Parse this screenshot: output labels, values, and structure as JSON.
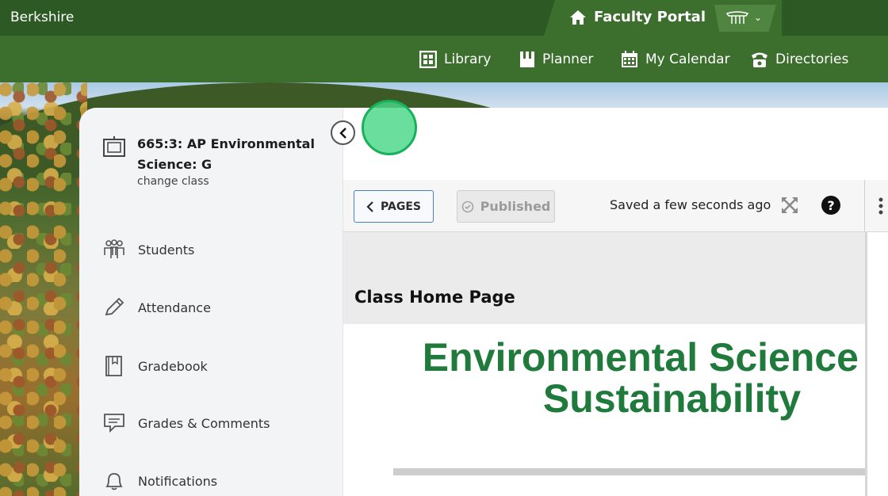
{
  "topbar": {
    "school_name": "Berkshire",
    "portal_label": "Faculty Portal"
  },
  "nav": {
    "items": [
      {
        "label": "Library",
        "icon": "grid-icon"
      },
      {
        "label": "Planner",
        "icon": "planner-icon"
      },
      {
        "label": "My Calendar",
        "icon": "calendar-icon"
      },
      {
        "label": "Directories",
        "icon": "phone-icon"
      }
    ]
  },
  "sidebar": {
    "class_title": "665:3: AP Environmental Science: G",
    "change_class": "change class",
    "items": [
      {
        "label": "Students",
        "icon": "students-icon"
      },
      {
        "label": "Attendance",
        "icon": "pencil-icon"
      },
      {
        "label": "Gradebook",
        "icon": "book-icon"
      },
      {
        "label": "Grades & Comments",
        "icon": "comment-icon"
      },
      {
        "label": "Notifications",
        "icon": "bell-icon"
      }
    ]
  },
  "toolbar": {
    "pages_label": "PAGES",
    "published_label": "Published",
    "saved_status": "Saved a few seconds ago"
  },
  "content": {
    "page_title": "Class Home Page",
    "headline_line1": "Environmental Science",
    "headline_line2": "Sustainability"
  },
  "colors": {
    "brand_dark": "#2d5a24",
    "brand": "#3c6e2d",
    "headline_green": "#1f7a3c",
    "accent_blue": "#4a7fc1"
  }
}
